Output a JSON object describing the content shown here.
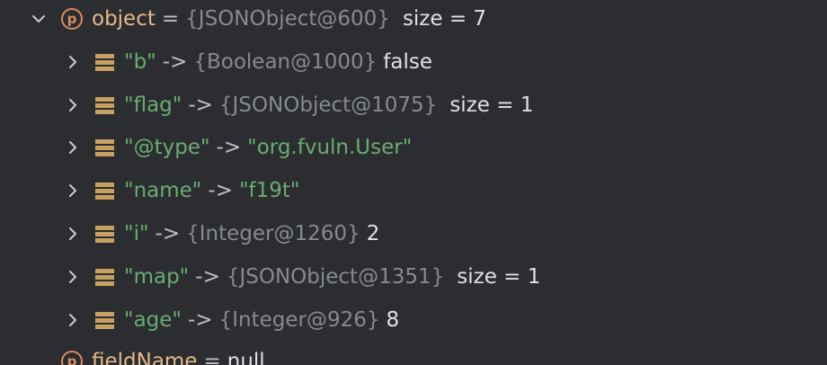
{
  "root": {
    "name": "object",
    "eq": "=",
    "ref": "{JSONObject@600}",
    "size": "size = 7"
  },
  "children": [
    {
      "key": "\"b\"",
      "arrow": "->",
      "ref": "{Boolean@1000}",
      "value": "false"
    },
    {
      "key": "\"flag\"",
      "arrow": "->",
      "ref": "{JSONObject@1075}",
      "value": "size = 1"
    },
    {
      "key": "\"@type\"",
      "arrow": "->",
      "ref": "",
      "value": "\"org.fvuln.User\""
    },
    {
      "key": "\"name\"",
      "arrow": "->",
      "ref": "",
      "value": "\"f19t\""
    },
    {
      "key": "\"i\"",
      "arrow": "->",
      "ref": "{Integer@1260}",
      "value": "2"
    },
    {
      "key": "\"map\"",
      "arrow": "->",
      "ref": "{JSONObject@1351}",
      "value": "size = 1"
    },
    {
      "key": "\"age\"",
      "arrow": "->",
      "ref": "{Integer@926}",
      "value": "8"
    }
  ],
  "next": {
    "name": "fieldName",
    "eq": "=",
    "value": "null"
  },
  "icons": {
    "expanded": "chevron-down-icon",
    "collapsed": "chevron-right-icon",
    "property": "property-p-icon",
    "field": "map-entry-icon"
  },
  "colors": {
    "background": "#2b2d30",
    "var_name": "#e5b889",
    "string": "#6aab73",
    "ref": "#868a91",
    "text": "#dfe1e5",
    "icon_field": "#c7a163",
    "icon_property": "#d98c5f"
  }
}
